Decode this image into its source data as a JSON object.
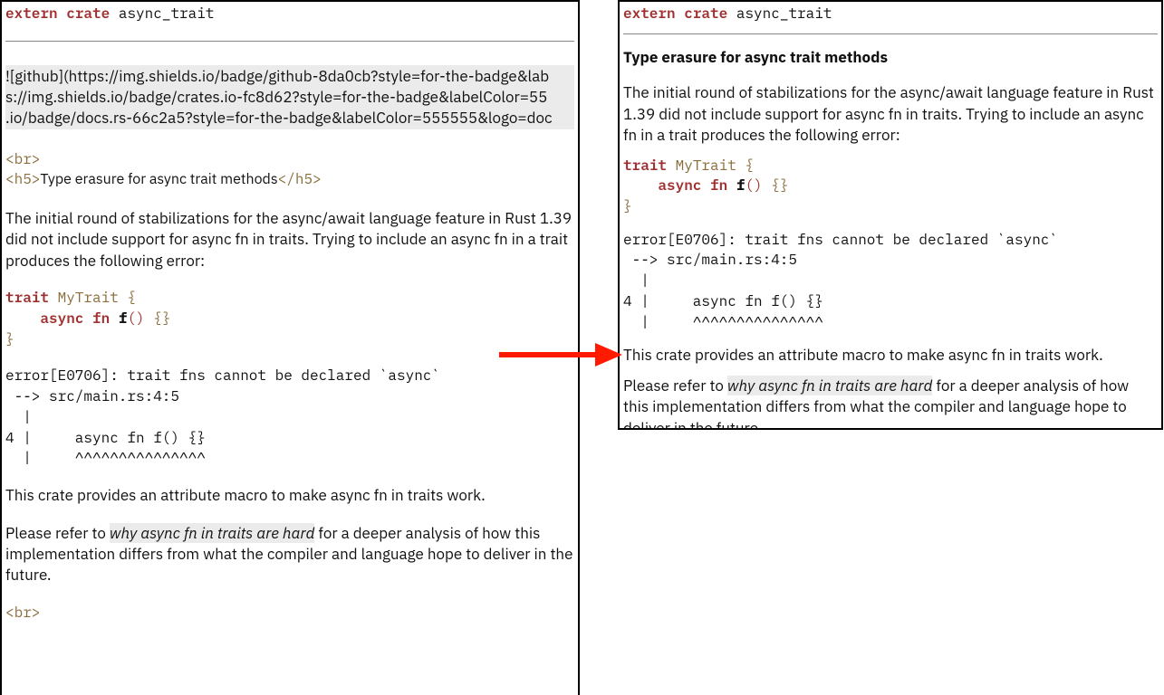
{
  "code_header": {
    "extern": "extern",
    "crate": "crate",
    "name": "async_trait"
  },
  "left": {
    "badges_line1": "![github](https://img.shields.io/badge/github-8da0cb?style=for-the-badge&lab",
    "badges_line2": "s://img.shields.io/badge/crates.io-fc8d62?style=for-the-badge&labelColor=55",
    "badges_line3": ".io/badge/docs.rs-66c2a5?style=for-the-badge&labelColor=555555&logo=doc",
    "br_tag": "<br>",
    "h5_open": "<h5>",
    "h5_close": "</h5>"
  },
  "shared": {
    "heading": "Type erasure for async trait methods",
    "intro": "The initial round of stabilizations for the async/await language feature in Rust 1.39 did not include support for async fn in traits. Trying to include an async fn in a trait produces the following error:",
    "code": {
      "trait": "trait",
      "name": "MyTrait",
      "open": "{",
      "indent": "    ",
      "async": "async",
      "fn_kw": "fn",
      "fn_name": "f",
      "parens": "()",
      "body": "{}",
      "close": "}"
    },
    "err1": "error[E0706]: trait fns cannot be declared `async`",
    "err2": " --> src/main.rs:4:5",
    "err3": "  |",
    "err4": "4 |     async fn f() {}",
    "err5": "  |     ^^^^^^^^^^^^^^^",
    "outro1": "This crate provides an attribute macro to make async fn in traits work.",
    "outro2a": "Please refer to ",
    "link": "why async fn in traits are hard",
    "outro2b": " for a deeper analysis of how this implementation differs from what the compiler and language hope to deliver in the future."
  }
}
